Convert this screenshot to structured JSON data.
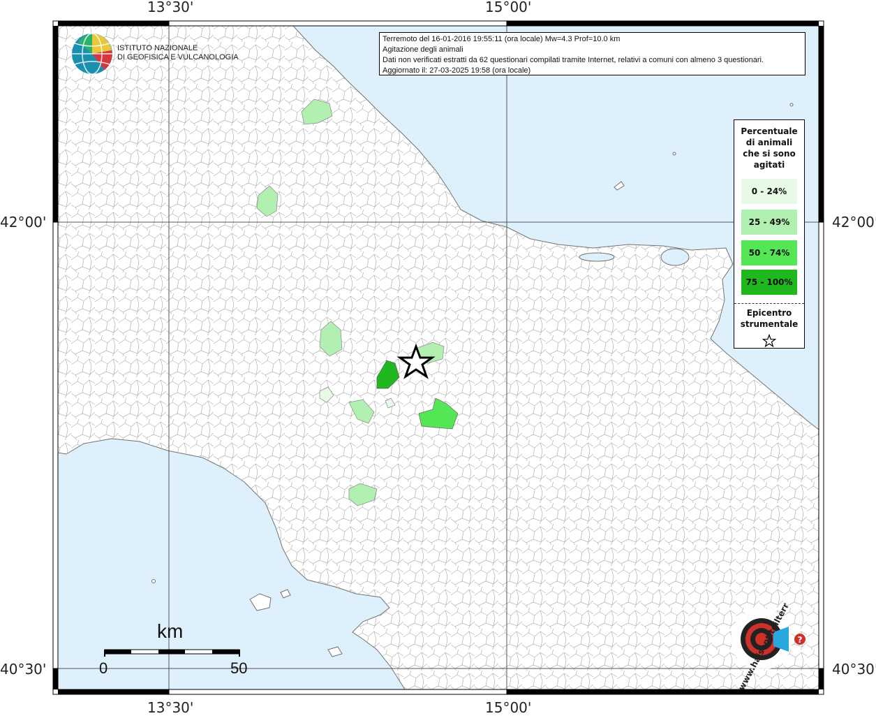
{
  "map": {
    "coords": {
      "top_left_lon": "13°30'",
      "top_right_lon": "15°00'",
      "bottom_left_lon": "13°30'",
      "bottom_right_lon": "15°00'",
      "left_upper_lat": "42°00'",
      "right_upper_lat": "42°00'",
      "left_lower_lat": "40°30'",
      "right_lower_lat": "40°30'"
    },
    "colors": {
      "sea": "#def0fb",
      "land": "#ffffff",
      "border": "#a0a0a0",
      "class_0_24": "#e6fae6",
      "class_25_49": "#b2f0b2",
      "class_50_74": "#55e655",
      "class_75_100": "#1fb91f"
    }
  },
  "logo": {
    "name": "ingv-globe-logo",
    "line1": "ISTITUTO NAZIONALE",
    "line2": "DI GEOFISICA E VULCANOLOGIA"
  },
  "info": {
    "line1": "Terremoto del 16-01-2016 19:55:11 (ora locale) Mw=4.3 Prof=10.0 km",
    "line2": "Agitazione degli animali",
    "line3": "Dati non verificati estratti da 62 questionari compilati tramite Internet, relativi a comuni con almeno 3 questionari.",
    "line4": "Aggiornato il: 27-03-2025 19:58 (ora locale)"
  },
  "legend": {
    "title_1": "Percentuale",
    "title_2": "di animali",
    "title_3": "che si sono",
    "title_4": "agitati",
    "items": [
      {
        "label": "0 - 24%",
        "color": "#e6fae6"
      },
      {
        "label": "25 - 49%",
        "color": "#b2f0b2"
      },
      {
        "label": "50 - 74%",
        "color": "#55e655"
      },
      {
        "label": "75 - 100%",
        "color": "#1fb91f"
      }
    ],
    "epicenter_1": "Epicentro",
    "epicenter_2": "strumentale",
    "epicenter_icon": "star-outline-icon"
  },
  "scale": {
    "unit": "km",
    "min": "0",
    "max": "50"
  },
  "watermark": {
    "name": "haisentitoilterremoto-logo",
    "text": "www.haisentitoilterremoto.it"
  }
}
